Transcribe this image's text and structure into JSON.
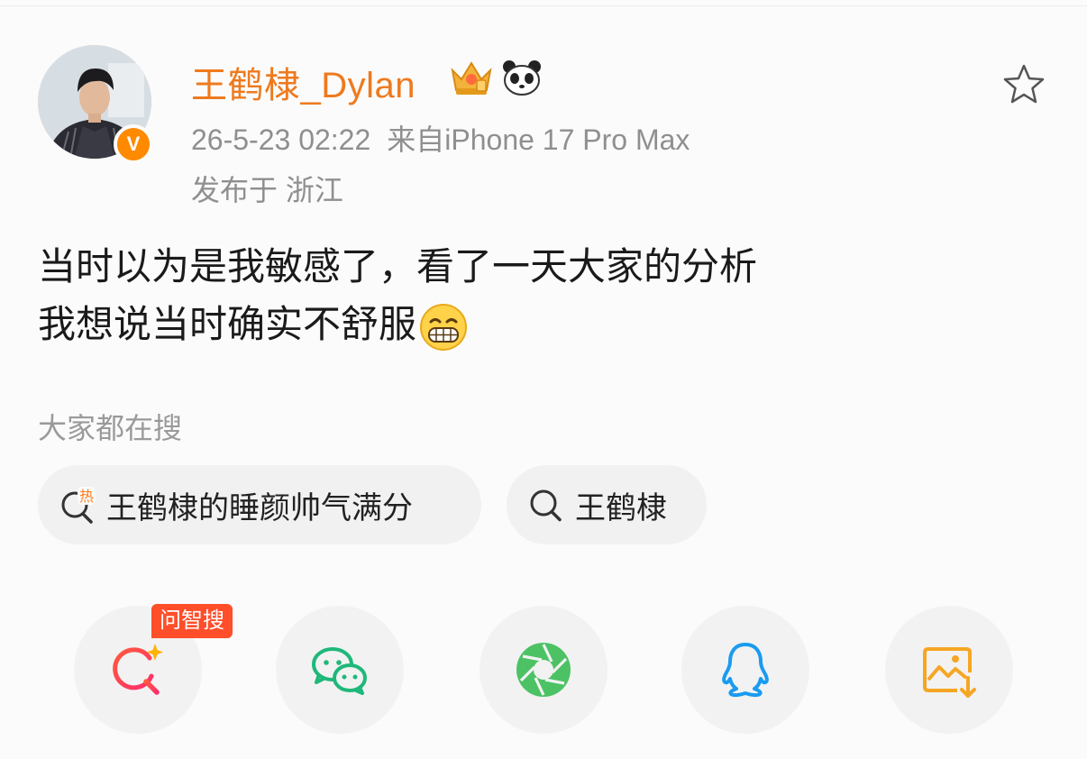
{
  "post": {
    "author": {
      "name": "王鹤棣_Dylan",
      "verified_mark": "V"
    },
    "time": "26-5-23 02:22",
    "source": "来自iPhone 17 Pro Max",
    "location": "发布于 浙江",
    "text_lines": [
      "当时以为是我敏感了，看了一天大家的分析",
      "我想说当时确实不舒服"
    ]
  },
  "searches": {
    "title": "大家都在搜",
    "hot_badge": "热",
    "items": [
      {
        "label": "王鹤棣的睡颜帅气满分",
        "icon": "hot-search-icon"
      },
      {
        "label": "王鹤棣",
        "icon": "search-icon"
      }
    ]
  },
  "share": {
    "ai_tag": "问智搜",
    "buttons": [
      {
        "icon": "ai-search-icon"
      },
      {
        "icon": "wechat-icon"
      },
      {
        "icon": "moments-icon"
      },
      {
        "icon": "qq-icon"
      },
      {
        "icon": "save-image-icon"
      }
    ]
  },
  "colors": {
    "username": "#ee7a1e",
    "meta": "#8f8f8f",
    "badge": "#ff8a00",
    "tag": "#ff4e2a"
  }
}
